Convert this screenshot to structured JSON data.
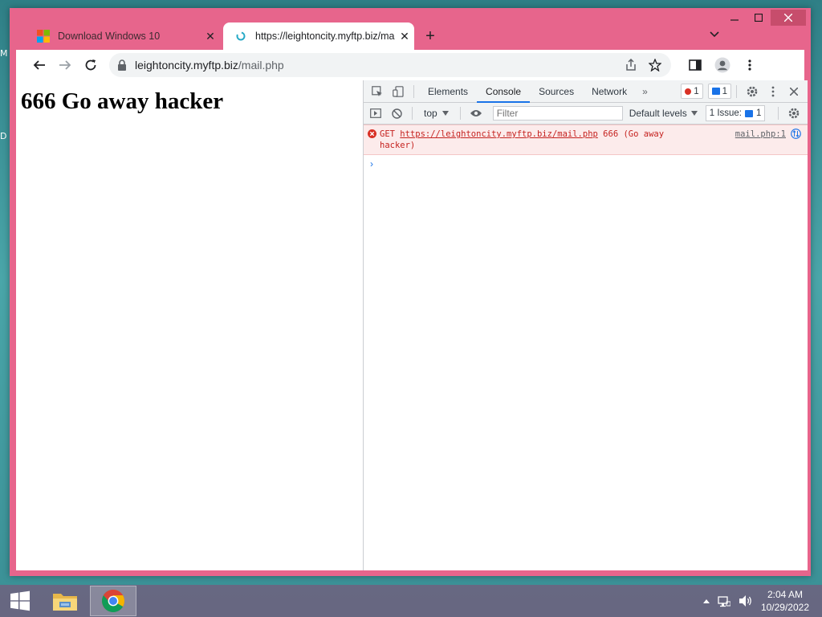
{
  "desktop": {
    "edge_labels": [
      "M",
      "D"
    ]
  },
  "browser": {
    "tabs": [
      {
        "title": "Download Windows 10",
        "active": false
      },
      {
        "title": "https://leightoncity.myftp.biz/mail.php",
        "active": true
      }
    ],
    "url_host": "leightoncity.myftp.biz",
    "url_path": "/mail.php"
  },
  "page": {
    "heading": "666 Go away hacker"
  },
  "devtools": {
    "tabs": [
      "Elements",
      "Console",
      "Sources",
      "Network"
    ],
    "active_tab": "Console",
    "error_count": "1",
    "message_count": "1",
    "context": "top",
    "filter_placeholder": "Filter",
    "levels_label": "Default levels",
    "issues_label": "1 Issue:",
    "issues_count": "1",
    "console_error": {
      "method": "GET",
      "url": "https://leightoncity.myftp.biz/mail.php",
      "status_text": "666 (Go away",
      "status_text_2": "hacker)",
      "source": "mail.php:1"
    },
    "prompt": "›"
  },
  "taskbar": {
    "time": "2:04 AM",
    "date": "10/29/2022"
  }
}
